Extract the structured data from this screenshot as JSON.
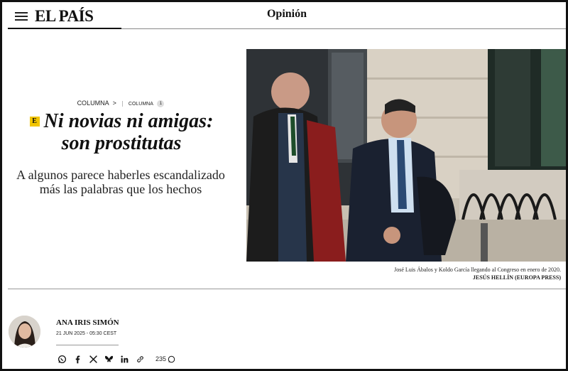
{
  "header": {
    "logo": "EL PAÍS",
    "section": "Opinión"
  },
  "breadcrumb": {
    "category": "COLUMNA",
    "separator": ">",
    "subcategory": "COLUMNA",
    "count": "1"
  },
  "article": {
    "badge": "E",
    "headline": "Ni novias ni amigas: son prostitutas",
    "subheadline": "A algunos parece haberles escandalizado más las palabras que los hechos"
  },
  "photo": {
    "caption": "José Luis Ábalos y Koldo García llegando al Congreso en enero de 2020.",
    "credit": "JESÚS HELLÍN (EUROPA PRESS)"
  },
  "author": {
    "name": "ANA IRIS SIMÓN",
    "date": "21 JUN 2025 - 05:30 CEST"
  },
  "share": {
    "icons": [
      "whatsapp-icon",
      "facebook-icon",
      "x-icon",
      "bluesky-icon",
      "linkedin-icon",
      "link-icon"
    ],
    "comments_count": "235"
  },
  "colors": {
    "badge": "#f2c500",
    "text": "#111111"
  }
}
